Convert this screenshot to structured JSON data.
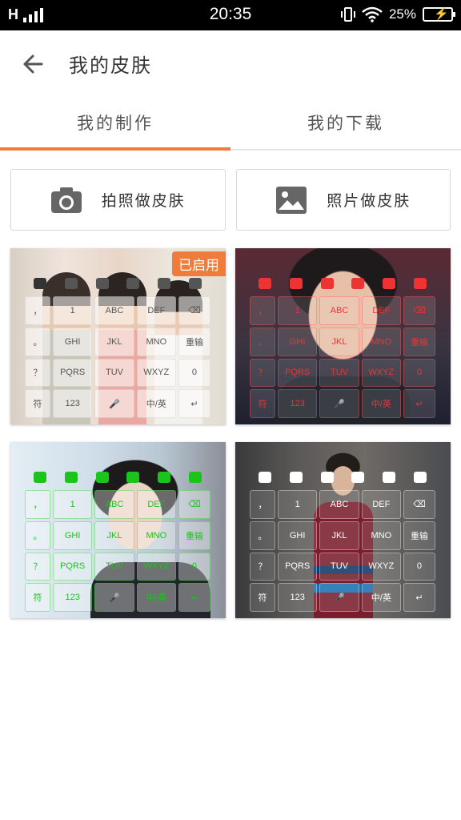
{
  "status_bar": {
    "network": "H",
    "time": "20:35",
    "battery": "25%"
  },
  "header": {
    "title": "我的皮肤",
    "back_icon": "arrow-left-icon"
  },
  "tabs": [
    {
      "label": "我的制作",
      "active": true
    },
    {
      "label": "我的下载",
      "active": false
    }
  ],
  "actions": {
    "camera_label": "拍照做皮肤",
    "photo_label": "照片做皮肤"
  },
  "skins": [
    {
      "badge": "已启用",
      "theme": "light"
    },
    {
      "badge": "",
      "theme": "red"
    },
    {
      "badge": "",
      "theme": "green"
    },
    {
      "badge": "",
      "theme": "white"
    }
  ],
  "keyboard": {
    "rows": [
      [
        "，",
        "1",
        "ABC",
        "DEF",
        "⌫"
      ],
      [
        "。",
        "GHI",
        "JKL",
        "MNO",
        "重输"
      ],
      [
        "？",
        "PQRS",
        "TUV",
        "WXYZ",
        "0"
      ],
      [
        "符",
        "123",
        "🎤",
        "中/英",
        "↵"
      ]
    ]
  },
  "colors": {
    "accent": "#f07c3c",
    "status_bar": "#000000"
  }
}
